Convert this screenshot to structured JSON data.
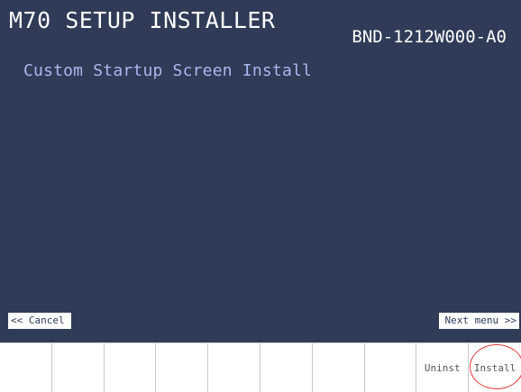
{
  "header": {
    "title": "M70 SETUP INSTALLER",
    "model": "BND-1212W000-A0"
  },
  "main": {
    "subtitle": "Custom Startup Screen Install"
  },
  "menu": {
    "cancel_label": "<< Cancel",
    "next_label": "Next menu >>"
  },
  "function_keys": [
    {
      "label": ""
    },
    {
      "label": ""
    },
    {
      "label": ""
    },
    {
      "label": ""
    },
    {
      "label": ""
    },
    {
      "label": ""
    },
    {
      "label": ""
    },
    {
      "label": ""
    },
    {
      "label": "Uninst"
    },
    {
      "label": "Install"
    }
  ],
  "colors": {
    "background": "#2f3b57",
    "subtitle_text": "#a9b8ec",
    "highlight_circle": "#e03b3b"
  }
}
